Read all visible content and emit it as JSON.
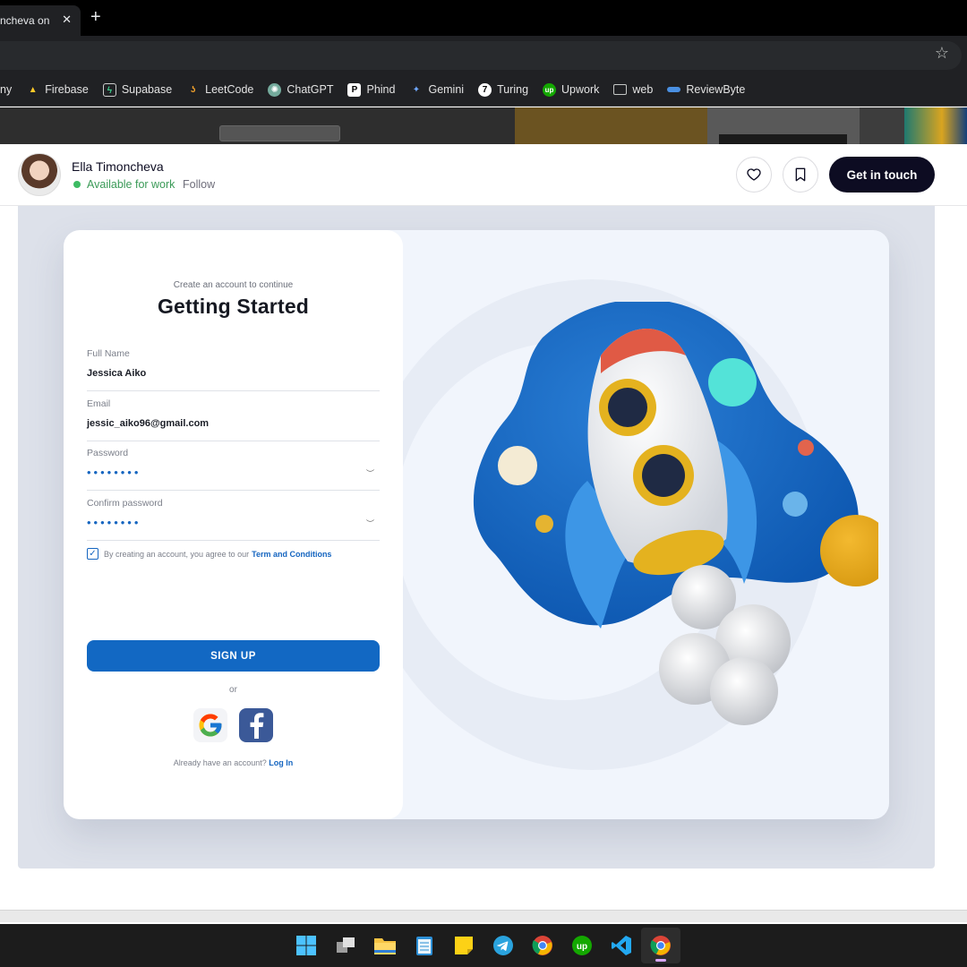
{
  "browser": {
    "tab_title": "ncheva on",
    "tab_close": "✕",
    "new_tab": "+",
    "bookmarks": [
      {
        "label": "ny",
        "icon": "none"
      },
      {
        "label": "Firebase",
        "icon": "firebase-icon"
      },
      {
        "label": "Supabase",
        "icon": "supabase-icon"
      },
      {
        "label": "LeetCode",
        "icon": "leetcode-icon"
      },
      {
        "label": "ChatGPT",
        "icon": "chatgpt-icon"
      },
      {
        "label": "Phind",
        "icon": "phind-icon"
      },
      {
        "label": "Gemini",
        "icon": "gemini-icon"
      },
      {
        "label": "Turing",
        "icon": "turing-icon"
      },
      {
        "label": "Upwork",
        "icon": "upwork-icon"
      },
      {
        "label": "web",
        "icon": "folder-icon"
      },
      {
        "label": "ReviewByte",
        "icon": "reviewbyte-icon"
      }
    ]
  },
  "header": {
    "author_name": "Ella Timoncheva",
    "availability": "Available for work",
    "follow": "Follow",
    "cta": "Get in touch"
  },
  "form": {
    "subtitle": "Create an account to continue",
    "title": "Getting Started",
    "fields": [
      {
        "label": "Full Name",
        "value": "Jessica Aiko"
      },
      {
        "label": "Email",
        "value": "jessic_aiko96@gmail.com"
      },
      {
        "label": "Password",
        "value": "••••••••"
      },
      {
        "label": "Confirm password",
        "value": "••••••••"
      }
    ],
    "agree_text": "By creating an account, you agree to our",
    "agree_link": "Term and Conditions",
    "signup_label": "SIGN UP",
    "or_label": "or",
    "login_prompt": "Already have an account?",
    "login_link": "Log In"
  },
  "colors": {
    "primary": "#1268c3",
    "cta": "#0d0c22",
    "available": "#3dbb63",
    "canvas": "#dde1ea"
  }
}
